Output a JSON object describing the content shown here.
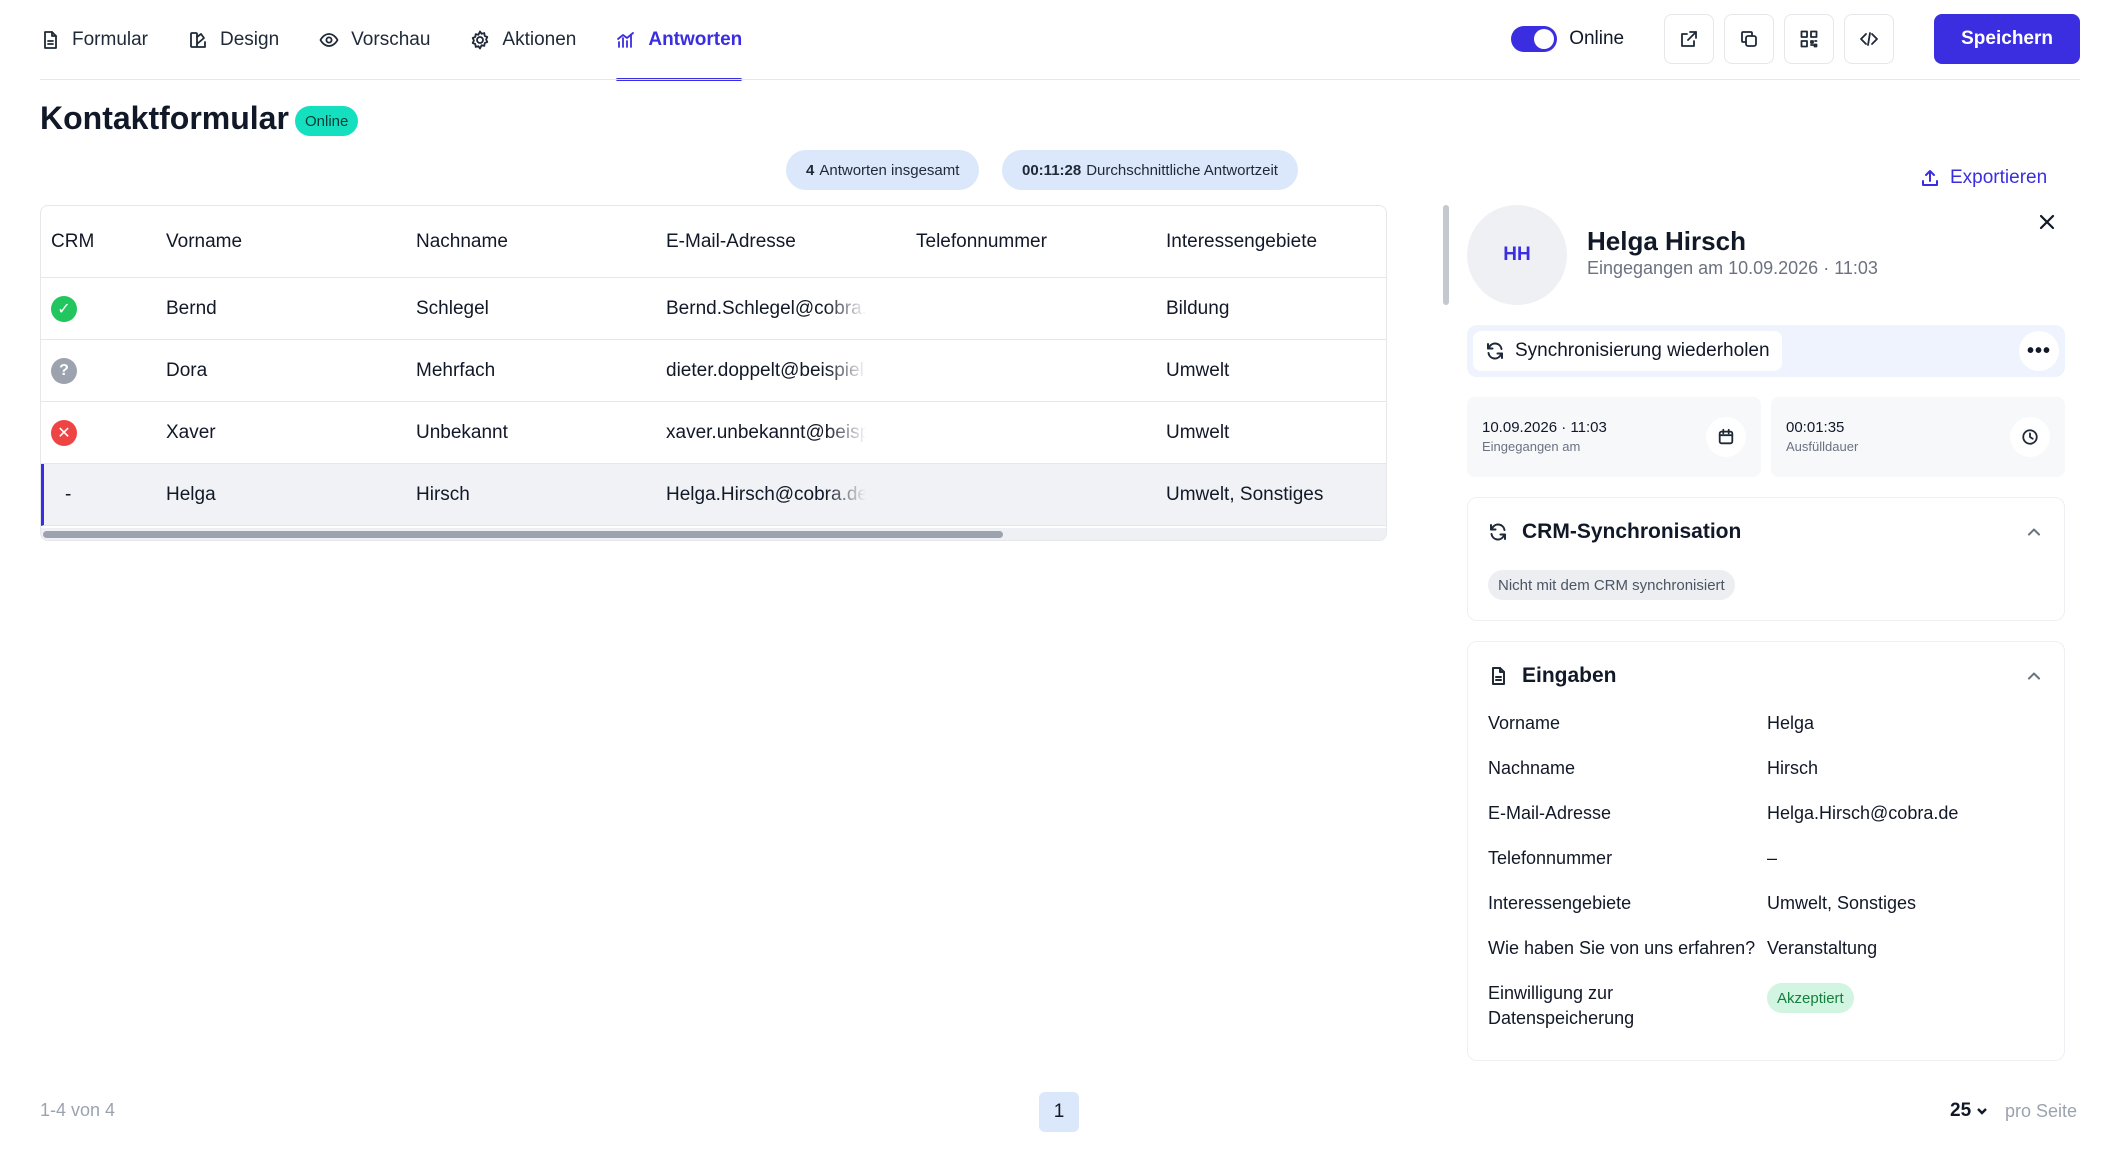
{
  "nav": {
    "tabs": [
      {
        "label": "Formular",
        "icon": "document-icon"
      },
      {
        "label": "Design",
        "icon": "palette-icon"
      },
      {
        "label": "Vorschau",
        "icon": "eye-icon"
      },
      {
        "label": "Aktionen",
        "icon": "gear-icon"
      },
      {
        "label": "Antworten",
        "icon": "chart-icon",
        "active": true
      }
    ],
    "online_label": "Online",
    "online_enabled": true,
    "save_label": "Speichern"
  },
  "page": {
    "title": "Kontaktformular",
    "status": "Online"
  },
  "stats": {
    "total_value": "4",
    "total_label": "Antworten insgesamt",
    "avg_value": "00:11:28",
    "avg_label": "Durchschnittliche Antwortzeit"
  },
  "export_label": "Exportieren",
  "table": {
    "columns": [
      "CRM",
      "Vorname",
      "Nachname",
      "E-Mail-Adresse",
      "Telefonnummer",
      "Interessengebiete"
    ],
    "rows": [
      {
        "crm": "synced",
        "vorname": "Bernd",
        "nachname": "Schlegel",
        "email": "Bernd.Schlegel@cobra.de",
        "telefon": "",
        "interessen": "Bildung"
      },
      {
        "crm": "unknown",
        "vorname": "Dora",
        "nachname": "Mehrfach",
        "email": "dieter.doppelt@beispiel.de",
        "telefon": "",
        "interessen": "Umwelt"
      },
      {
        "crm": "error",
        "vorname": "Xaver",
        "nachname": "Unbekannt",
        "email": "xaver.unbekannt@beispiel.de",
        "telefon": "",
        "interessen": "Umwelt"
      },
      {
        "crm": "-",
        "vorname": "Helga",
        "nachname": "Hirsch",
        "email": "Helga.Hirsch@cobra.de",
        "telefon": "",
        "interessen": "Umwelt, Sonstiges",
        "selected": true
      }
    ]
  },
  "detail": {
    "initials": "HH",
    "name": "Helga Hirsch",
    "subtitle": "Eingegangen am 10.09.2026 · 11:03",
    "sync_label": "Synchronisierung wiederholen",
    "received_value": "10.09.2026 · 11:03",
    "received_label": "Eingegangen am",
    "duration_value": "00:01:35",
    "duration_label": "Ausfülldauer",
    "crm_title": "CRM-Synchronisation",
    "crm_status": "Nicht mit dem CRM synchronisiert",
    "inputs_title": "Eingaben",
    "fields": [
      {
        "label": "Vorname",
        "value": "Helga"
      },
      {
        "label": "Nachname",
        "value": "Hirsch"
      },
      {
        "label": "E-Mail-Adresse",
        "value": "Helga.Hirsch@cobra.de"
      },
      {
        "label": "Telefonnummer",
        "value": "–"
      },
      {
        "label": "Interessengebiete",
        "value": "Umwelt, Sonstiges"
      },
      {
        "label": "Wie haben Sie von uns erfahren?",
        "value": "Veranstaltung"
      },
      {
        "label": "Einwilligung zur Datenspeicherung",
        "value": "Akzeptiert"
      }
    ]
  },
  "footer": {
    "range": "1-4 von 4",
    "current_page": "1",
    "per_page_value": "25",
    "per_page_label": "pro Seite"
  },
  "colors": {
    "accent": "#3a2ee0",
    "online_badge": "#14e0c0",
    "synced": "#22c55e",
    "error": "#ef4444",
    "unknown": "#9ca3af",
    "accepted": "#d1f5e0"
  }
}
